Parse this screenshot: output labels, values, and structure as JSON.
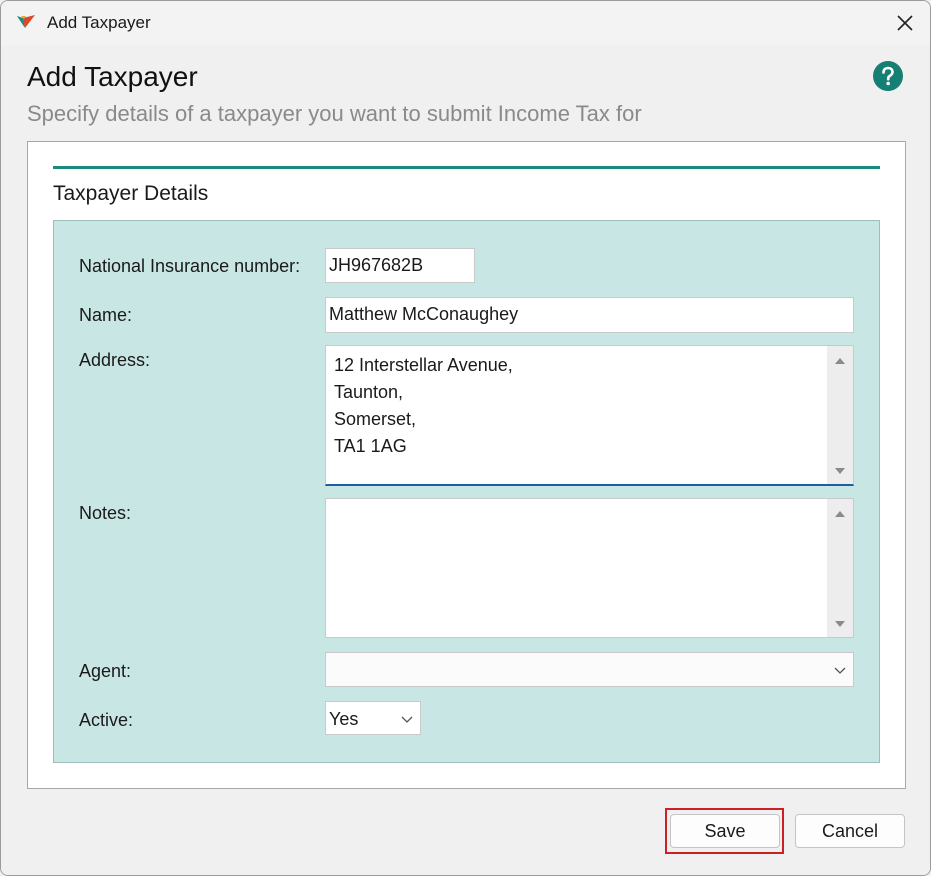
{
  "window": {
    "title": "Add Taxpayer"
  },
  "header": {
    "title": "Add Taxpayer",
    "subtitle": "Specify details of a taxpayer you want to submit Income Tax for"
  },
  "section": {
    "title": "Taxpayer Details"
  },
  "form": {
    "ni_label": "National Insurance number:",
    "ni_value": "JH967682B",
    "name_label": "Name:",
    "name_value": "Matthew McConaughey",
    "address_label": "Address:",
    "address_value": "12 Interstellar Avenue,\nTaunton,\nSomerset,\nTA1 1AG",
    "notes_label": "Notes:",
    "notes_value": "",
    "agent_label": "Agent:",
    "agent_value": "",
    "active_label": "Active:",
    "active_value": "Yes"
  },
  "buttons": {
    "save": "Save",
    "cancel": "Cancel"
  },
  "colors": {
    "accent": "#1c8a7c",
    "panel": "#c8e6e4",
    "focus": "#cc1f26",
    "help": "#167f73"
  },
  "icons": [
    "app-icon",
    "close-icon",
    "help-icon",
    "scroll-up-icon",
    "scroll-down-icon",
    "chevron-down-icon"
  ]
}
